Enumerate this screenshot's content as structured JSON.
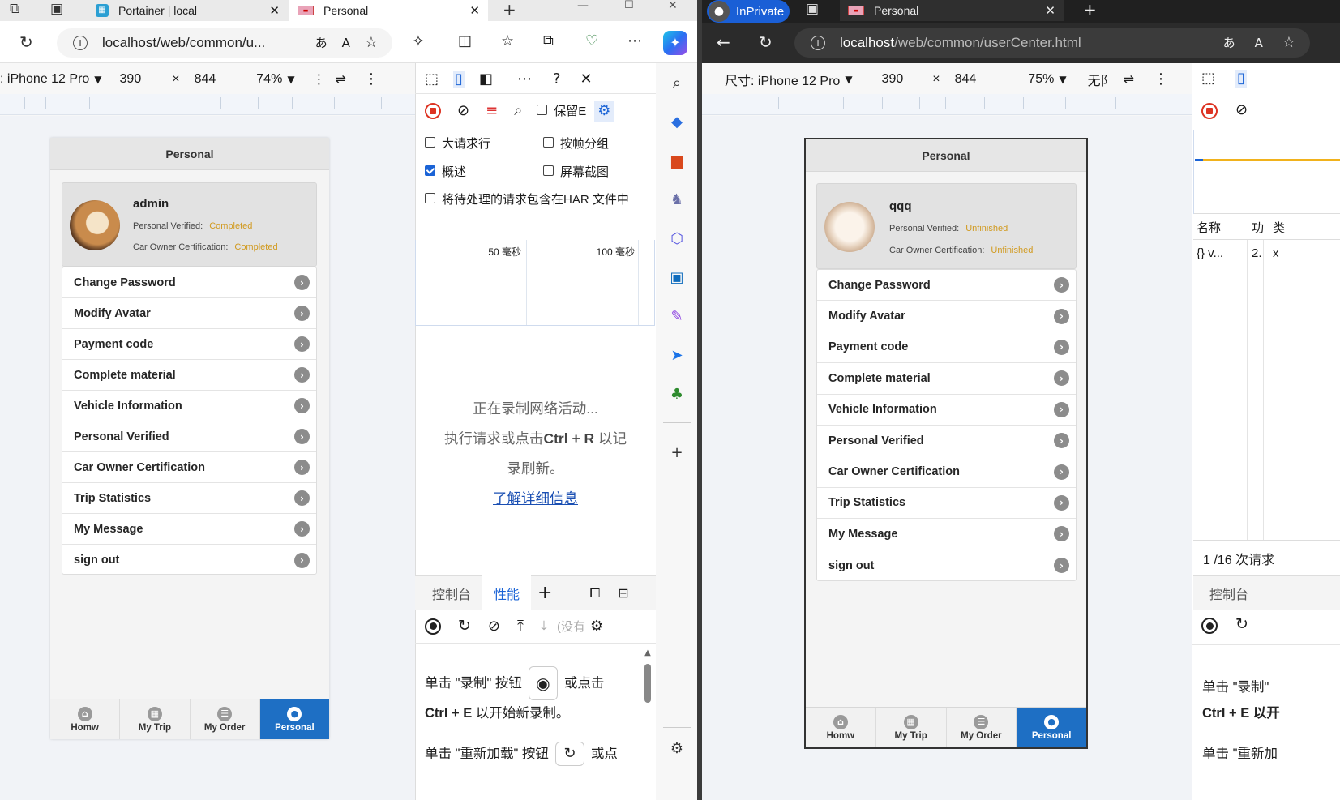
{
  "left_window": {
    "tab1_title": "Portainer | local",
    "tab2_title": "Personal",
    "address": "localhost/web/common/u...",
    "device": {
      "name": ": iPhone 12 Pro",
      "width": "390",
      "times": "×",
      "height": "844",
      "zoom": "74%"
    },
    "devtools": {
      "preserve_log": "保留E",
      "options": [
        "大请求行",
        "按帧分组",
        "概述",
        "屏幕截图",
        "将待处理的请求包含在HAR 文件中"
      ],
      "timeline_ticks": [
        "50 毫秒",
        "100 毫秒"
      ],
      "recording_line1": "正在录制网络活动...",
      "recording_line2_pre": "执行请求或点击",
      "recording_shortcut": "Ctrl + R",
      "recording_line2_post": " 以记",
      "recording_line3": "录刷新。",
      "learn_more": "了解详细信息",
      "drawer_tabs": [
        "控制台",
        "性能"
      ],
      "perf_stub": "(没有",
      "perf_text1_pre": "单击 \"录制\" 按钮",
      "perf_text1_post": "或点击",
      "perf_text2_key": "Ctrl + E",
      "perf_text2_post": " 以开始新录制。",
      "perf_text3_pre": "单击 \"重新加载\" 按钮",
      "perf_text3_post": "或点"
    }
  },
  "left_app": {
    "header": "Personal",
    "username": "admin",
    "personal_verified_label": "Personal Verified:",
    "personal_verified_value": "Completed",
    "car_owner_label": "Car Owner Certification:",
    "car_owner_value": "Completed",
    "status_color": "#d19a1f",
    "menu": [
      "Change Password",
      "Modify Avatar",
      "Payment code",
      "Complete material",
      "Vehicle Information",
      "Personal Verified",
      "Car Owner Certification",
      "Trip Statistics",
      "My Message",
      "sign out"
    ],
    "nav": [
      "Homw",
      "My Trip",
      "My Order",
      "Personal"
    ],
    "active_nav": "Personal",
    "accent": "#1e6fc4"
  },
  "right_window": {
    "inprivate": "InPrivate",
    "tab_title": "Personal",
    "address_host": "localhost",
    "address_path": "/web/common/userCenter.html",
    "device": {
      "name": "尺寸: iPhone 12 Pro",
      "width": "390",
      "times": "×",
      "height": "844",
      "zoom": "75%",
      "extra": "无阝"
    },
    "devtools": {
      "col_name": "名称",
      "col_x": "功",
      "col_y": "类",
      "row_name": "{} v...",
      "row_val": "2.",
      "row_x": "x",
      "requests": "1 /16 次请求",
      "drawer_tab": "控制台",
      "perf_text1": "单击 \"录制\"",
      "perf_text2": "Ctrl + E 以开",
      "perf_text3": "单击 \"重新加"
    }
  },
  "right_app": {
    "header": "Personal",
    "username": "qqq",
    "personal_verified_label": "Personal Verified:",
    "personal_verified_value": "Unfinished",
    "car_owner_label": "Car Owner Certification:",
    "car_owner_value": "Unfinished",
    "menu": [
      "Change Password",
      "Modify Avatar",
      "Payment code",
      "Complete material",
      "Vehicle Information",
      "Personal Verified",
      "Car Owner Certification",
      "Trip Statistics",
      "My Message",
      "sign out"
    ],
    "nav": [
      "Homw",
      "My Trip",
      "My Order",
      "Personal"
    ],
    "active_nav": "Personal"
  }
}
